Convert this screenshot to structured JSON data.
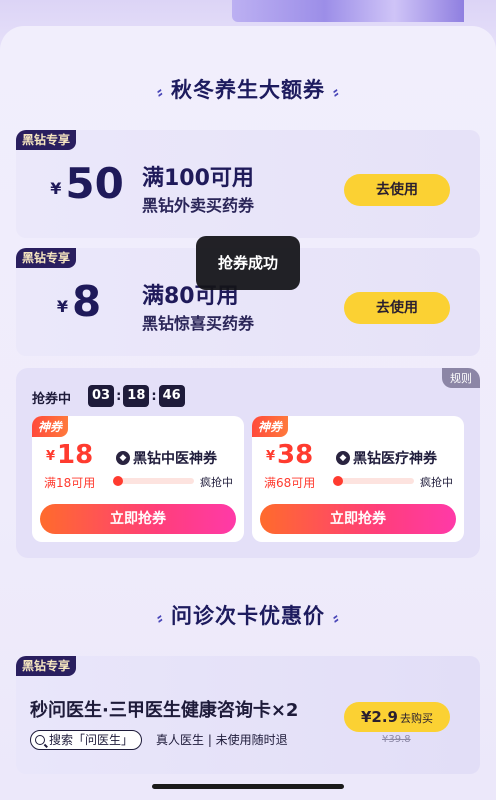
{
  "section1_title": "秋冬养生大额券",
  "coupons": [
    {
      "badge": "黑钻专享",
      "yen": "¥",
      "amount": "50",
      "condition": "满100可用",
      "desc": "黑钻外卖买药券",
      "button": "去使用"
    },
    {
      "badge": "黑钻专享",
      "yen": "¥",
      "amount": "8",
      "condition": "满80可用",
      "desc": "黑钻惊喜买药券",
      "button": "去使用"
    }
  ],
  "toast": "抢券成功",
  "flash": {
    "rule_label": "规则",
    "timer_label": "抢券中",
    "timer": {
      "h": "03",
      "m": "18",
      "s": "46"
    },
    "items": [
      {
        "tag": "神券",
        "yen": "¥",
        "amount": "18",
        "condition": "满18可用",
        "name": "黑钻中医神券",
        "status": "疯抢中",
        "progress": 0.08,
        "button": "立即抢券"
      },
      {
        "tag": "神券",
        "yen": "¥",
        "amount": "38",
        "condition": "满68可用",
        "name": "黑钻医疗神券",
        "status": "疯抢中",
        "progress": 0.08,
        "button": "立即抢券"
      }
    ]
  },
  "section2_title": "问诊次卡优惠价",
  "card": {
    "badge": "黑钻专享",
    "title": "秒问医生·三甲医生健康咨询卡×2",
    "search_chip": "搜索「问医生」",
    "subtitle": "真人医生 | 未使用随时退",
    "price": "¥2.9",
    "buy_label": "去购买",
    "original_price": "¥39.8"
  },
  "colors": {
    "accent_yellow": "#fbd133",
    "badge_dark": "#2a1f5f",
    "price_red": "#ff3b2f",
    "background": "#ede9fb"
  }
}
